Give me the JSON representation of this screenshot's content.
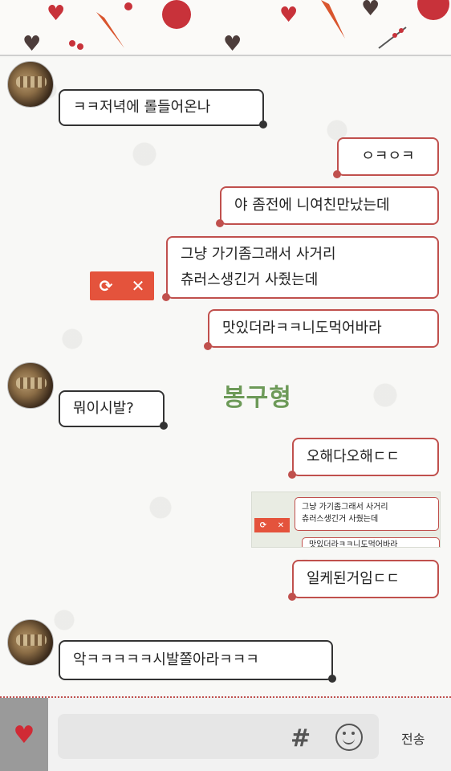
{
  "messages": [
    {
      "side": "in",
      "text": "ㅋㅋ저녁에 롤들어온나"
    },
    {
      "side": "out",
      "text": "ㅇㅋㅇㅋ"
    },
    {
      "side": "out",
      "text": "야 좀전에 니여친만났는데"
    },
    {
      "side": "out",
      "line1": "그냥 가기좀그래서 사거리",
      "line2": "츄러스생긴거 사줬는데"
    },
    {
      "side": "out",
      "text": "맛있더라ㅋㅋ니도먹어바라"
    },
    {
      "side": "in",
      "text": "뭐이시발?"
    },
    {
      "side": "out",
      "text": "오해다오해ㄷㄷ"
    },
    {
      "side": "out",
      "text": "일케된거임ㄷㄷ"
    },
    {
      "side": "in",
      "text": "악ㅋㅋㅋㅋㅋ시발쫄아라ㅋㅋㅋ"
    }
  ],
  "retry": {
    "icon": "⟳",
    "cancel": "✕"
  },
  "watermark": "봉구형",
  "quoted": {
    "line1": "그냥 가기좀그래서 사거리",
    "line2": "츄러스생긴거 사줬는데",
    "line3": "맛있더라ㅋㅋ니도먹어바라"
  },
  "input": {
    "hash": "#",
    "send_label": "전송"
  },
  "colors": {
    "accent": "#c0504d",
    "retry": "#e4533c"
  }
}
